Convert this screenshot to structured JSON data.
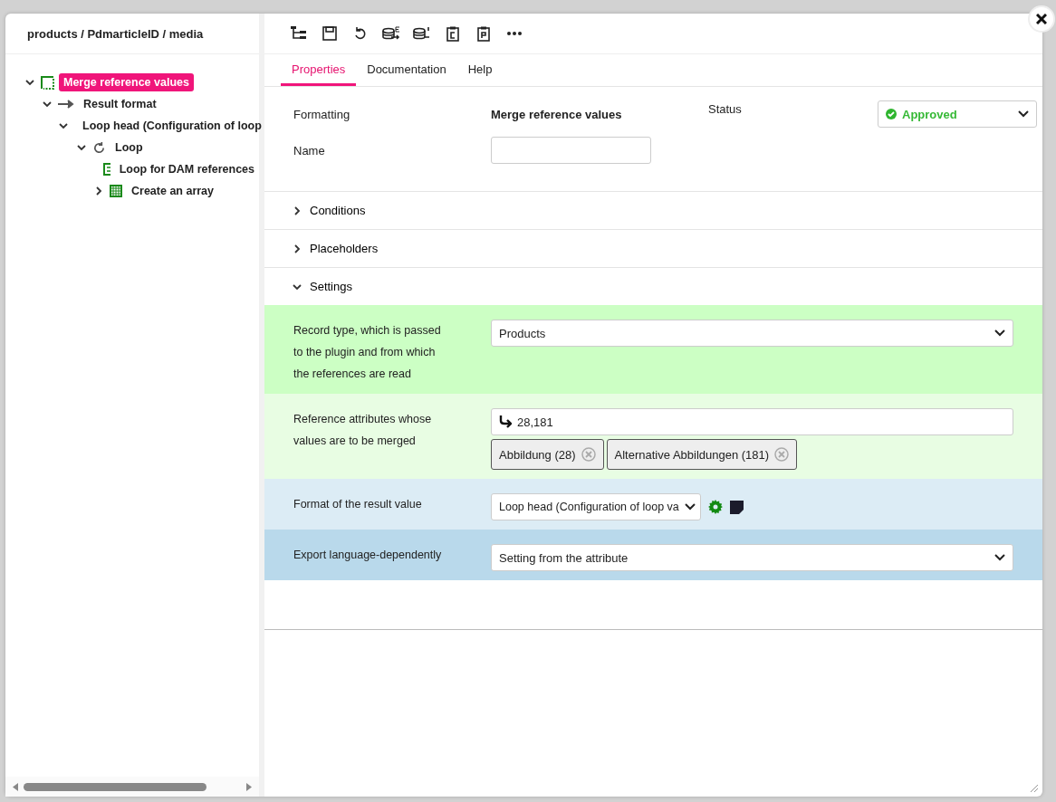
{
  "breadcrumb": "products / PdmarticleID / media",
  "tree": [
    {
      "label": "Merge reference values",
      "kind": "group",
      "expanded": true,
      "selected": true,
      "children": [
        {
          "label": "Result format",
          "kind": "arrow",
          "expanded": true,
          "selected": false,
          "children": [
            {
              "label": "Loop head (Configuration of loop",
              "kind": "group",
              "expanded": true,
              "selected": false,
              "children": [
                {
                  "label": "Loop",
                  "kind": "loop",
                  "expanded": true,
                  "selected": false,
                  "children": [
                    {
                      "label": "Loop for DAM references",
                      "kind": "list",
                      "selected": false
                    },
                    {
                      "label": "Create an array",
                      "kind": "grid",
                      "expanded": false,
                      "selected": false
                    }
                  ]
                }
              ]
            }
          ]
        }
      ]
    }
  ],
  "tabs": [
    {
      "label": "Properties",
      "selected": true
    },
    {
      "label": "Documentation",
      "selected": false
    },
    {
      "label": "Help",
      "selected": false
    }
  ],
  "header": {
    "formatting_label": "Formatting",
    "formatting_value": "Merge reference values",
    "status_label": "Status",
    "status_value": "Approved",
    "name_label": "Name"
  },
  "sections": [
    {
      "label": "Conditions",
      "expanded": false
    },
    {
      "label": "Placeholders",
      "expanded": false
    },
    {
      "label": "Settings",
      "expanded": true
    }
  ],
  "settings": [
    {
      "kind": "select",
      "label": "Record type, which is passed to the plugin and from which the references are read",
      "value": "Products",
      "color": "#ccffc4"
    },
    {
      "kind": "tags",
      "label": "Reference attributes whose values are to be merged",
      "value": "28,181",
      "tags": [
        "Abbildung (28)",
        "Alternative Abbildungen (181)"
      ],
      "color": "#e8fde3"
    },
    {
      "kind": "select-tools",
      "label": "Format of the result value",
      "value": "Loop head (Configuration of loop va",
      "color": "#dcecf5"
    },
    {
      "kind": "select",
      "label": "Export language-dependently",
      "value": "Setting from the attribute",
      "color": "#b9d9eb"
    }
  ]
}
